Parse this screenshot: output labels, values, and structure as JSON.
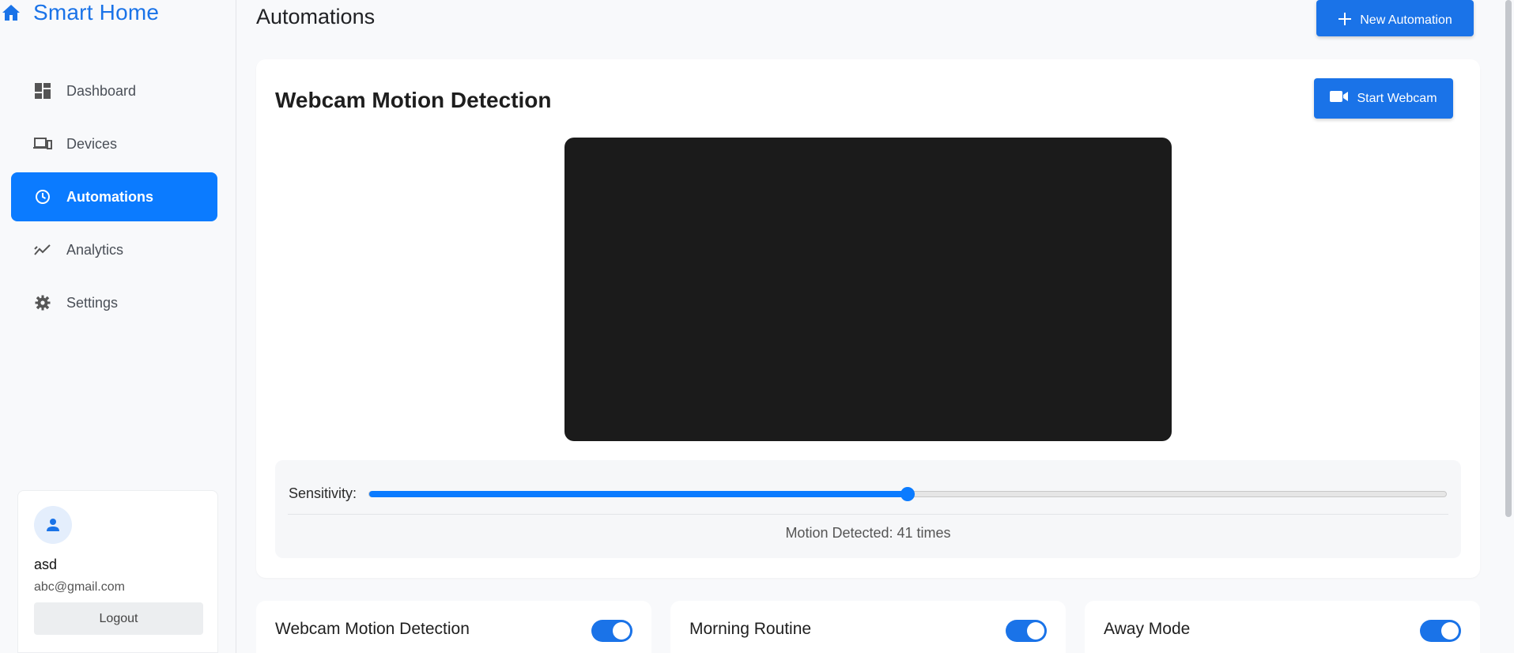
{
  "sidebar": {
    "brand": "Smart Home",
    "items": [
      {
        "label": "Dashboard",
        "icon": "dashboard-icon"
      },
      {
        "label": "Devices",
        "icon": "devices-icon"
      },
      {
        "label": "Automations",
        "icon": "clock-icon",
        "active": true
      },
      {
        "label": "Analytics",
        "icon": "analytics-icon"
      },
      {
        "label": "Settings",
        "icon": "gear-icon"
      }
    ],
    "user": {
      "name": "asd",
      "email": "abc@gmail.com",
      "logout_label": "Logout"
    }
  },
  "header": {
    "title": "Automations",
    "new_automation_label": "New Automation"
  },
  "webcam_card": {
    "title": "Webcam Motion Detection",
    "start_label": "Start Webcam",
    "sensitivity_label": "Sensitivity:",
    "sensitivity_value": 0.5,
    "motion_text": "Motion Detected: 41 times"
  },
  "automations": [
    {
      "name": "Webcam Motion Detection",
      "enabled": true
    },
    {
      "name": "Morning Routine",
      "enabled": true
    },
    {
      "name": "Away Mode",
      "enabled": true
    }
  ],
  "colors": {
    "accent": "#1a73e8",
    "active_nav": "#0b7bff",
    "video_bg": "#1b1b1b"
  }
}
